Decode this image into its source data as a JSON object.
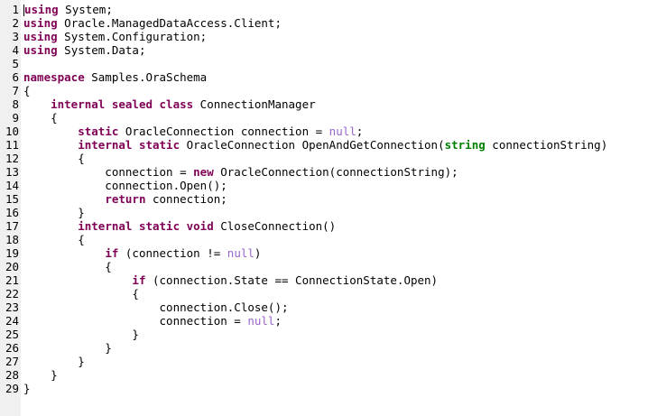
{
  "editor": {
    "colors": {
      "keyword": "#7f0055",
      "null": "#9966cc",
      "type": "#008000",
      "gutter": "#f0f0f0"
    },
    "lines": [
      [
        {
          "t": "using",
          "c": "kw"
        },
        {
          "t": " System;",
          "c": ""
        }
      ],
      [
        {
          "t": "using",
          "c": "kw"
        },
        {
          "t": " Oracle.ManagedDataAccess.Client;",
          "c": ""
        }
      ],
      [
        {
          "t": "using",
          "c": "kw"
        },
        {
          "t": " System.Configuration;",
          "c": ""
        }
      ],
      [
        {
          "t": "using",
          "c": "kw"
        },
        {
          "t": " System.Data;",
          "c": ""
        }
      ],
      [],
      [
        {
          "t": "namespace",
          "c": "kw"
        },
        {
          "t": " Samples.OraSchema",
          "c": ""
        }
      ],
      [
        {
          "t": "{",
          "c": ""
        }
      ],
      [
        {
          "t": "    ",
          "c": ""
        },
        {
          "t": "internal sealed class",
          "c": "kw"
        },
        {
          "t": " ConnectionManager",
          "c": ""
        }
      ],
      [
        {
          "t": "    {",
          "c": ""
        }
      ],
      [
        {
          "t": "        ",
          "c": ""
        },
        {
          "t": "static",
          "c": "kw"
        },
        {
          "t": " OracleConnection connection = ",
          "c": ""
        },
        {
          "t": "null",
          "c": "nul"
        },
        {
          "t": ";",
          "c": ""
        }
      ],
      [
        {
          "t": "        ",
          "c": ""
        },
        {
          "t": "internal static",
          "c": "kw"
        },
        {
          "t": " OracleConnection OpenAndGetConnection(",
          "c": ""
        },
        {
          "t": "string",
          "c": "typ"
        },
        {
          "t": " connectionString)",
          "c": ""
        }
      ],
      [
        {
          "t": "        {",
          "c": ""
        }
      ],
      [
        {
          "t": "            connection = ",
          "c": ""
        },
        {
          "t": "new",
          "c": "kw"
        },
        {
          "t": " OracleConnection(connectionString);",
          "c": ""
        }
      ],
      [
        {
          "t": "            connection.Open();",
          "c": ""
        }
      ],
      [
        {
          "t": "            ",
          "c": ""
        },
        {
          "t": "return",
          "c": "kw"
        },
        {
          "t": " connection;",
          "c": ""
        }
      ],
      [
        {
          "t": "        }",
          "c": ""
        }
      ],
      [
        {
          "t": "        ",
          "c": ""
        },
        {
          "t": "internal static void",
          "c": "kw"
        },
        {
          "t": " CloseConnection()",
          "c": ""
        }
      ],
      [
        {
          "t": "        {",
          "c": ""
        }
      ],
      [
        {
          "t": "            ",
          "c": ""
        },
        {
          "t": "if",
          "c": "kw"
        },
        {
          "t": " (connection != ",
          "c": ""
        },
        {
          "t": "null",
          "c": "nul"
        },
        {
          "t": ")",
          "c": ""
        }
      ],
      [
        {
          "t": "            {",
          "c": ""
        }
      ],
      [
        {
          "t": "                ",
          "c": ""
        },
        {
          "t": "if",
          "c": "kw"
        },
        {
          "t": " (connection.State == ConnectionState.Open)",
          "c": ""
        }
      ],
      [
        {
          "t": "                {",
          "c": ""
        }
      ],
      [
        {
          "t": "                    connection.Close();",
          "c": ""
        }
      ],
      [
        {
          "t": "                    connection = ",
          "c": ""
        },
        {
          "t": "null",
          "c": "nul"
        },
        {
          "t": ";",
          "c": ""
        }
      ],
      [
        {
          "t": "                }",
          "c": ""
        }
      ],
      [
        {
          "t": "            }",
          "c": ""
        }
      ],
      [
        {
          "t": "        }",
          "c": ""
        }
      ],
      [
        {
          "t": "    }",
          "c": ""
        }
      ],
      [
        {
          "t": "}",
          "c": ""
        }
      ]
    ]
  }
}
